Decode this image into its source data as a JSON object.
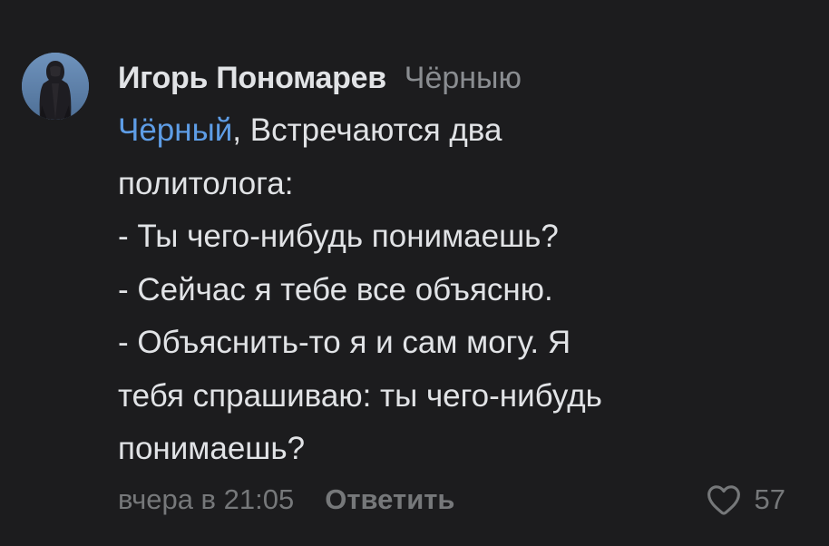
{
  "comment": {
    "author": "Игорь Пономарев",
    "reply_to": "Чёрныю",
    "mention": "Чёрный",
    "body_lines": [
      ", Встречаются два",
      "политолога:",
      "- Ты чего-нибудь понимаешь?",
      "- Сейчас я тебе все объясню.",
      "- Объяснить-то я и сам могу. Я",
      "тебя спрашиваю: ты чего-нибудь",
      "понимаешь?"
    ],
    "timestamp": "вчера в 21:05",
    "reply_label": "Ответить",
    "likes": "57",
    "like_icon": "heart-outline-icon"
  },
  "colors": {
    "background": "#1c1c1e",
    "text": "#e1e3e6",
    "secondary": "#76787a",
    "link": "#5e9de6"
  }
}
